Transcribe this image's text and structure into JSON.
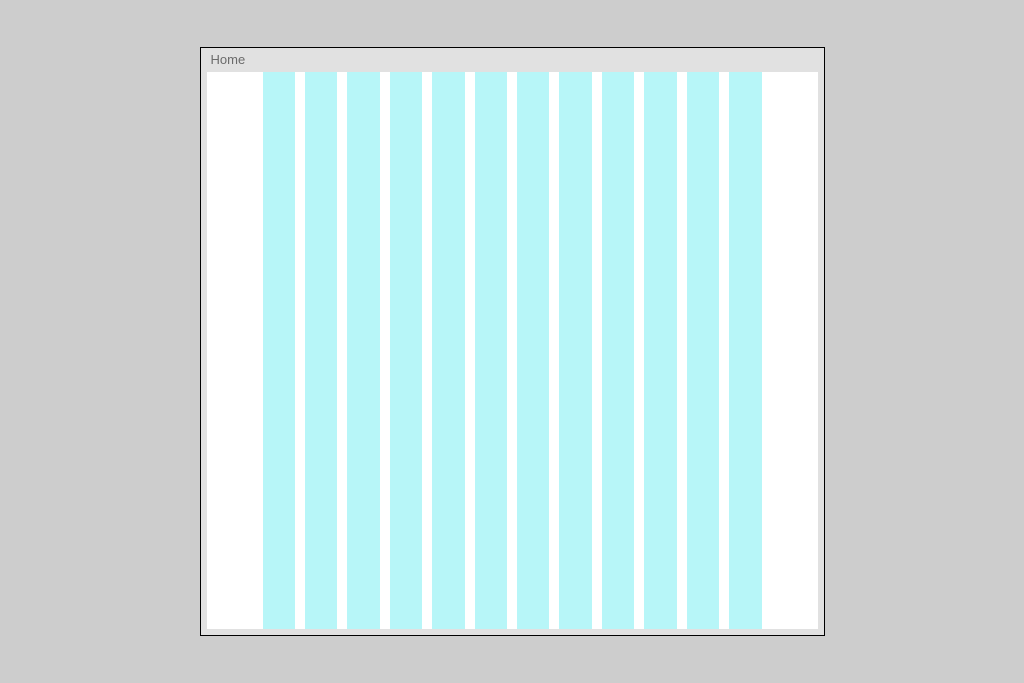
{
  "window": {
    "title": "Home"
  },
  "grid": {
    "columns": 12,
    "column_color": "#b7f6f8"
  }
}
